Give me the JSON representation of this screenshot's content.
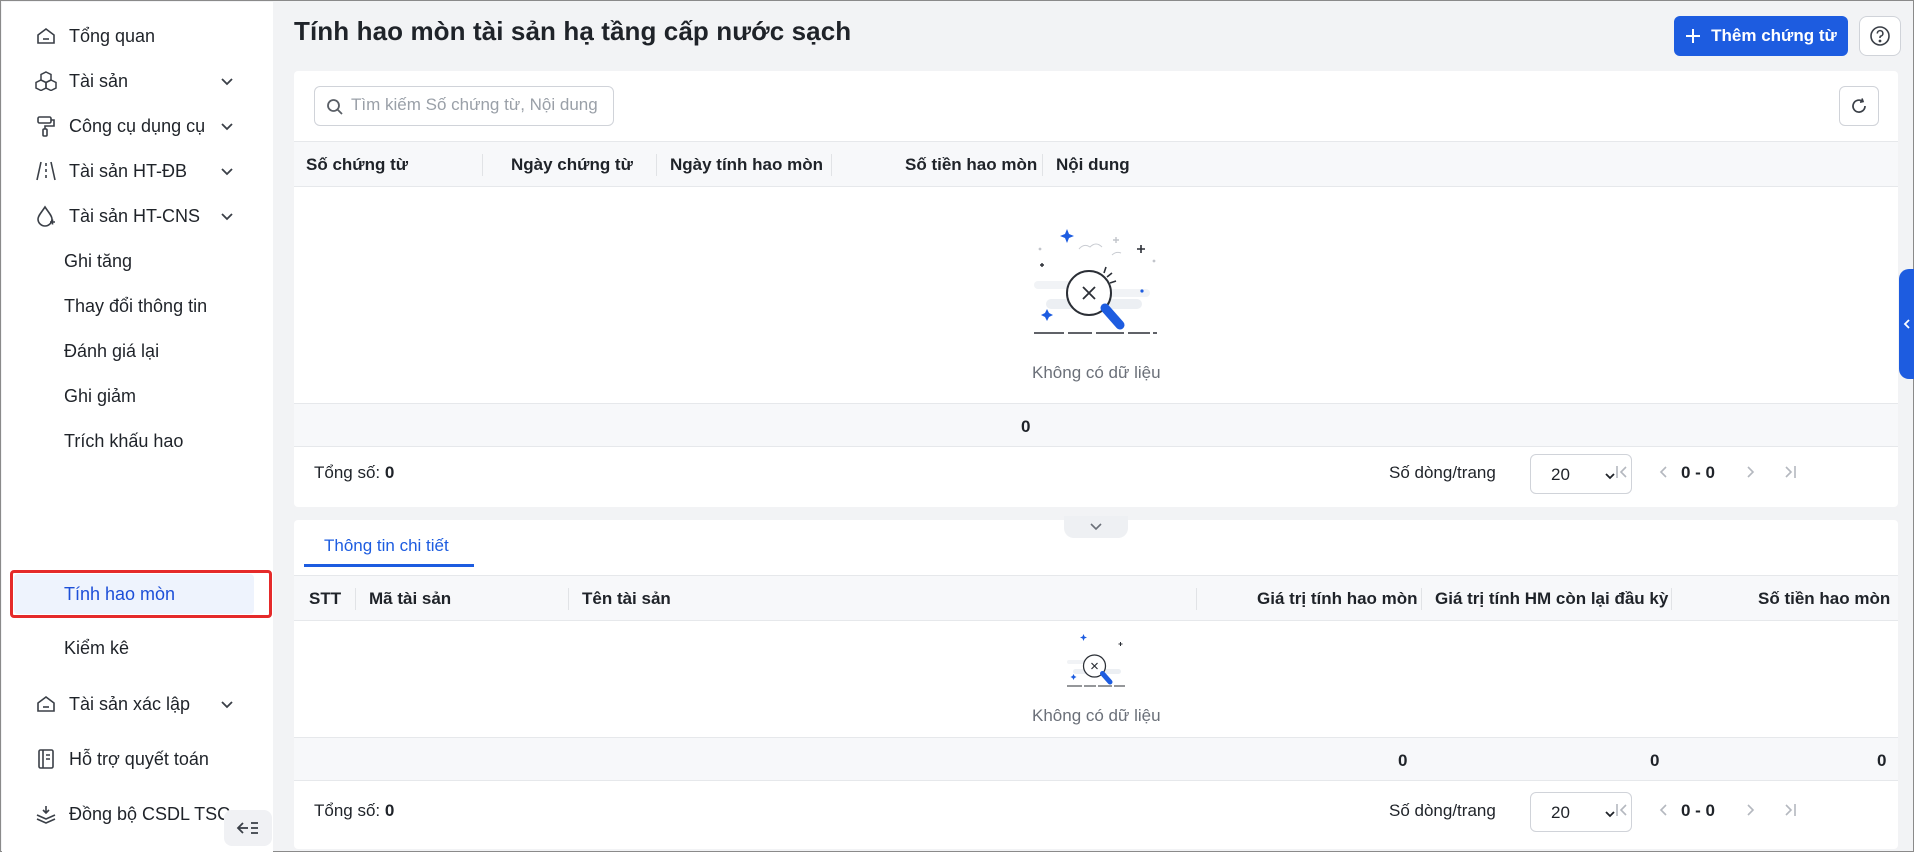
{
  "sidebar": {
    "items": [
      {
        "label": "Tổng quan",
        "icon": "home-icon",
        "has_chevron": false
      },
      {
        "label": "Tài sản",
        "icon": "cubes-icon",
        "has_chevron": true
      },
      {
        "label": "Công cụ dụng cụ",
        "icon": "paint-roller-icon",
        "has_chevron": true
      },
      {
        "label": "Tài sản HT-ĐB",
        "icon": "road-icon",
        "has_chevron": true
      },
      {
        "label": "Tài sản HT-CNS",
        "icon": "water-drop-icon",
        "has_chevron": true
      }
    ],
    "sub_items": [
      "Ghi tăng",
      "Thay đổi thông tin",
      "Đánh giá lại",
      "Ghi giảm",
      "Trích khấu hao",
      "Tính hao mòn",
      "Kiểm kê"
    ],
    "active_sub": "Tính hao mòn",
    "bottom_items": [
      {
        "label": "Tài sản xác lập",
        "icon": "home-icon",
        "has_chevron": true
      },
      {
        "label": "Hỗ trợ quyết toán",
        "icon": "ledger-icon",
        "has_chevron": false
      },
      {
        "label": "Đồng bộ CSDL TSC",
        "icon": "layers-sync-icon",
        "has_chevron": false
      }
    ]
  },
  "header": {
    "title": "Tính hao mòn tài sản hạ tầng cấp nước sạch",
    "add_button": "Thêm chứng từ"
  },
  "search": {
    "placeholder": "Tìm kiếm Số chứng từ, Nội dung"
  },
  "main_table": {
    "columns": [
      "Số chứng từ",
      "Ngày chứng từ",
      "Ngày tính hao mòn",
      "Số tiền hao mòn",
      "Nội dung"
    ],
    "empty_text": "Không có dữ liệu",
    "summary_value": "0",
    "footer": {
      "total_label": "Tổng số:",
      "total_value": "0",
      "rows_per_page_label": "Số dòng/trang",
      "rows_per_page": "20",
      "range": "0 - 0"
    }
  },
  "detail": {
    "tab": "Thông tin chi tiết",
    "columns": [
      "STT",
      "Mã tài sản",
      "Tên tài sản",
      "Giá trị tính hao mòn",
      "Giá trị tính HM còn lại đầu kỳ",
      "Số tiền hao mòn"
    ],
    "empty_text": "Không có dữ liệu",
    "summary_values": [
      "0",
      "0",
      "0"
    ],
    "footer": {
      "total_label": "Tổng số:",
      "total_value": "0",
      "rows_per_page_label": "Số dòng/trang",
      "rows_per_page": "20",
      "range": "0 - 0"
    }
  },
  "colors": {
    "primary": "#1d5ce0",
    "active_text": "#1d4fd8",
    "highlight_border": "#e52a2a"
  }
}
